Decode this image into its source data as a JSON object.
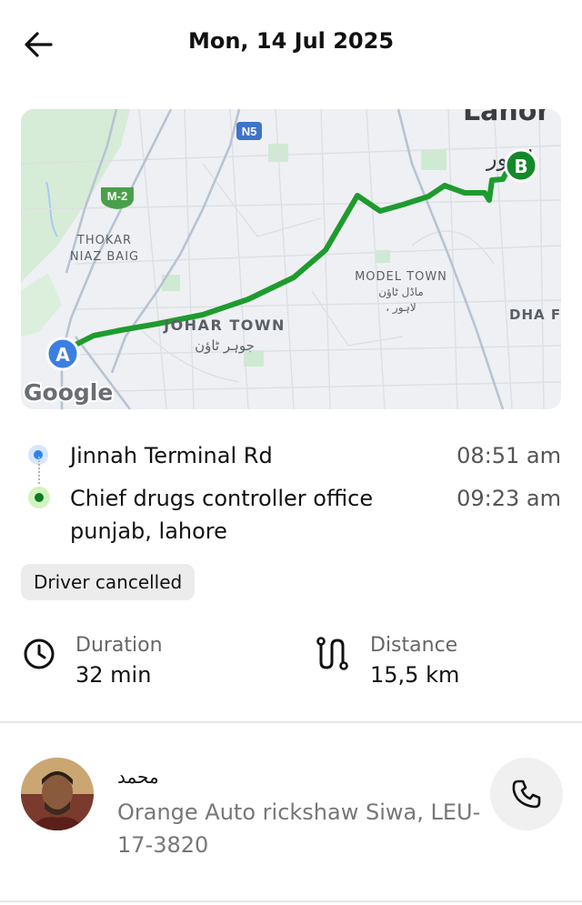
{
  "header": {
    "title": "Mon, 14 Jul 2025",
    "back_icon": "arrow-left-icon"
  },
  "map": {
    "labels": {
      "thokar_line1": "THOKAR",
      "thokar_line2": "NIAZ BAIG",
      "johar_town": "JOHAR TOWN",
      "johar_town_urdu": "جوہر ٹاؤن",
      "model_town": "MODEL TOWN",
      "model_town_urdu1": "ماڈل ٹاؤن",
      "model_town_urdu2": "، لاہور",
      "dha": "DHA F",
      "lahore": "Lahor",
      "lahore_urdu": "لاہور",
      "road_n5": "N5",
      "road_m2": "M-2",
      "google": "Google",
      "marker_a": "A",
      "marker_b": "B"
    },
    "colors": {
      "route": "#1e9b2e",
      "marker_a": "#3b7fe3",
      "marker_b": "#12892a"
    }
  },
  "trip": {
    "pickup": {
      "name": "Jinnah Terminal Rd",
      "time": "08:51 am"
    },
    "dropoff": {
      "name": "Chief drugs controller office punjab, lahore",
      "time": "09:23 am"
    },
    "status": "Driver cancelled"
  },
  "metrics": {
    "duration": {
      "label": "Duration",
      "value": "32 min",
      "icon": "clock-icon"
    },
    "distance": {
      "label": "Distance",
      "value": "15,5 km",
      "icon": "route-icon"
    }
  },
  "driver": {
    "name": "محمد",
    "vehicle": "Orange Auto rickshaw Siwa, LEU-17-3820",
    "call_icon": "phone-icon"
  }
}
